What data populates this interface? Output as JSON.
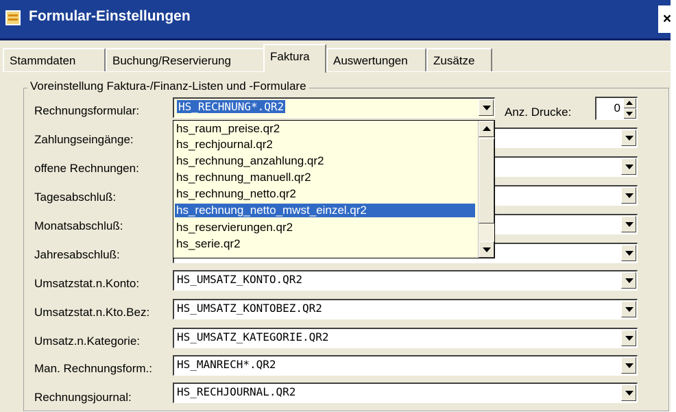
{
  "window": {
    "title": "Formular-Einstellungen",
    "close_label": "×"
  },
  "tabs": [
    {
      "label": "Stammdaten"
    },
    {
      "label": "Buchung/Reservierung"
    },
    {
      "label": "Faktura"
    },
    {
      "label": "Auswertungen"
    },
    {
      "label": "Zusätze"
    }
  ],
  "active_tab": "Faktura",
  "group": {
    "title": "Voreinstellung Faktura-/Finanz-Listen und -Formulare"
  },
  "rows": [
    {
      "label": "Rechnungsformular:",
      "value": "HS_RECHNUNG*.QR2"
    },
    {
      "label": "Zahlungseingänge:",
      "value": ""
    },
    {
      "label": "offene Rechnungen:",
      "value": ""
    },
    {
      "label": "Tagesabschluß:",
      "value": ""
    },
    {
      "label": "Monatsabschluß:",
      "value": ""
    },
    {
      "label": "Jahresabschluß:",
      "value": ""
    },
    {
      "label": "Umsatzstat.n.Konto:",
      "value": "HS_UMSATZ_KONTO.QR2"
    },
    {
      "label": "Umsatzstat.n.Kto.Bez:",
      "value": "HS_UMSATZ_KONTOBEZ.QR2"
    },
    {
      "label": "Umsatz.n.Kategorie:",
      "value": "HS_UMSATZ_KATEGORIE.QR2"
    },
    {
      "label": "Man. Rechnungsform.:",
      "value": "HS_MANRECH*.QR2"
    },
    {
      "label": "Rechnungsjournal:",
      "value": "HS_RECHJOURNAL.QR2"
    }
  ],
  "anz_drucke": {
    "label": "Anz. Drucke:",
    "value": "0"
  },
  "dropdown": {
    "items": [
      "hs_raum_preise.qr2",
      "hs_rechjournal.qr2",
      "hs_rechnung_anzahlung.qr2",
      "hs_rechnung_manuell.qr2",
      "hs_rechnung_netto.qr2",
      "hs_rechnung_netto_mwst_einzel.qr2",
      "hs_reservierungen.qr2",
      "hs_serie.qr2"
    ],
    "selected_index": 5
  },
  "colors": {
    "titlebar": "#1b3f95",
    "selection": "#316ac5",
    "combo_highlight": "#ffffe1",
    "face": "#ece9d8"
  }
}
